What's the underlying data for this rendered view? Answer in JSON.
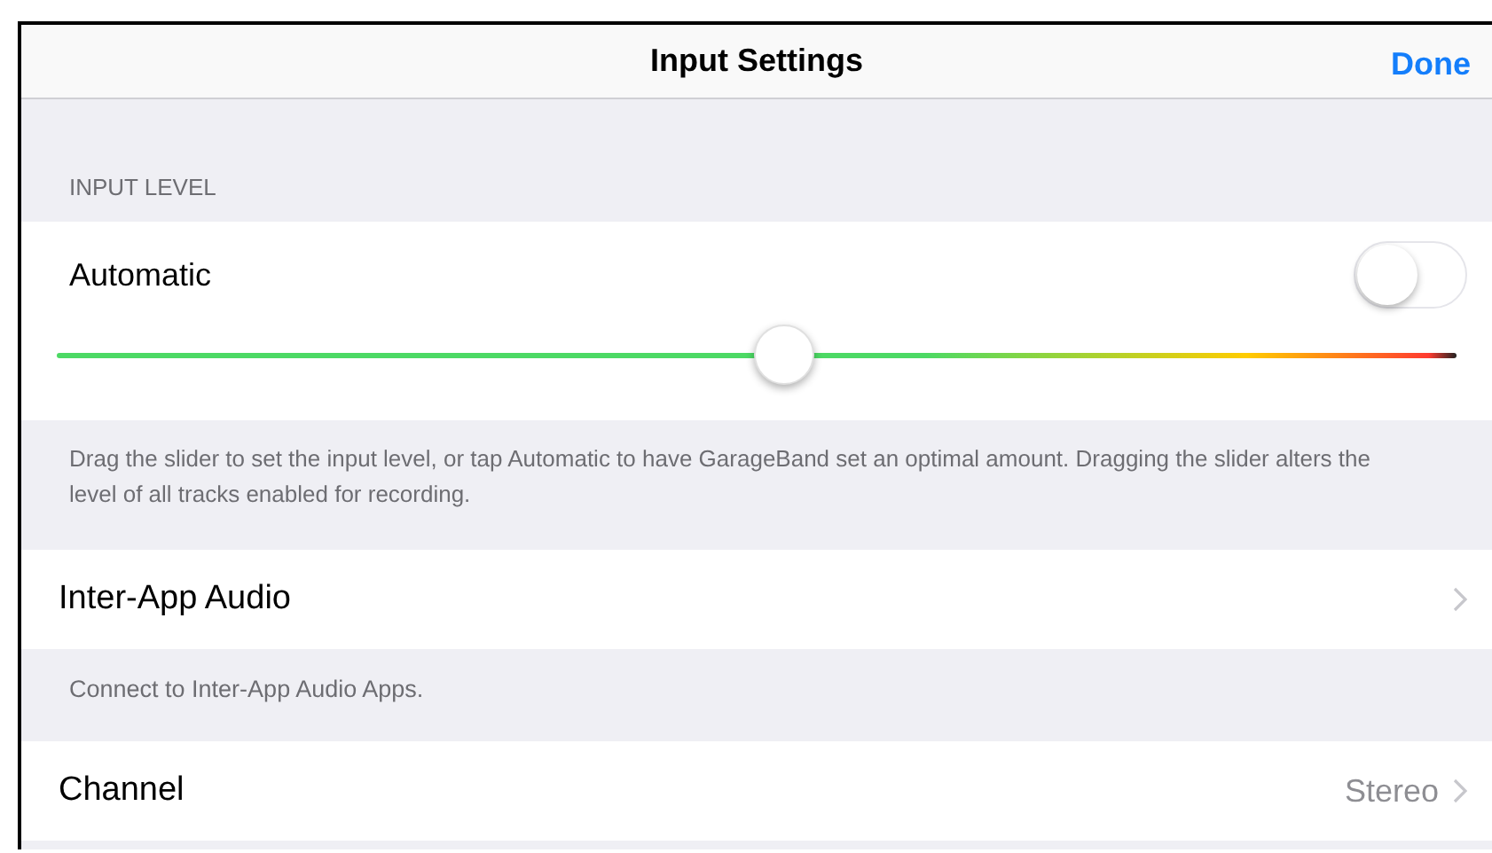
{
  "nav_bar": {
    "title": "Input Settings",
    "done_button": "Done"
  },
  "input_level": {
    "header": "INPUT LEVEL",
    "automatic": {
      "label": "Automatic",
      "on": false
    },
    "slider": {
      "level": 0.52
    },
    "footer": "Drag the slider to set the input level, or tap Automatic to have GarageBand set an optimal amount. Dragging the slider alters the level of all tracks enabled for recording."
  },
  "rows": [
    {
      "label": "Inter-App Audio",
      "footer": "Connect to Inter-App Audio Apps."
    },
    {
      "label": "Channel",
      "value": "Stereo"
    }
  ]
}
